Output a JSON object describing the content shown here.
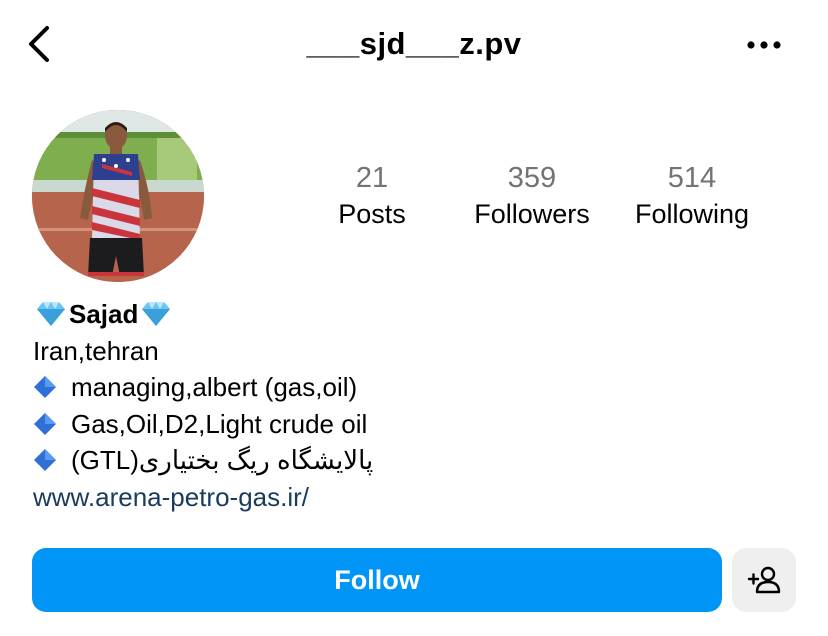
{
  "header": {
    "username": "___sjd___z.pv"
  },
  "icons": {
    "back": "chevron-left-icon",
    "more": "more-horizontal-icon",
    "suggest": "add-person-icon"
  },
  "stats": {
    "posts": {
      "value": "21",
      "label": "Posts"
    },
    "followers": {
      "value": "359",
      "label": "Followers"
    },
    "following": {
      "value": "514",
      "label": "Following"
    }
  },
  "bio": {
    "name": "Sajad",
    "location": "Iran,tehran",
    "line1": "managing,albert (gas,oil)",
    "line2": "Gas,Oil,D2,Light crude oil",
    "line3": "پالایشگاه ریگ بختیاری(GTL)",
    "link": "www.arena-petro-gas.ir/"
  },
  "actions": {
    "follow_label": "Follow"
  },
  "colors": {
    "follow_button": "#0095f6",
    "suggest_button": "#efefef",
    "stat_number": "#737373",
    "link": "#1a3b5e"
  }
}
